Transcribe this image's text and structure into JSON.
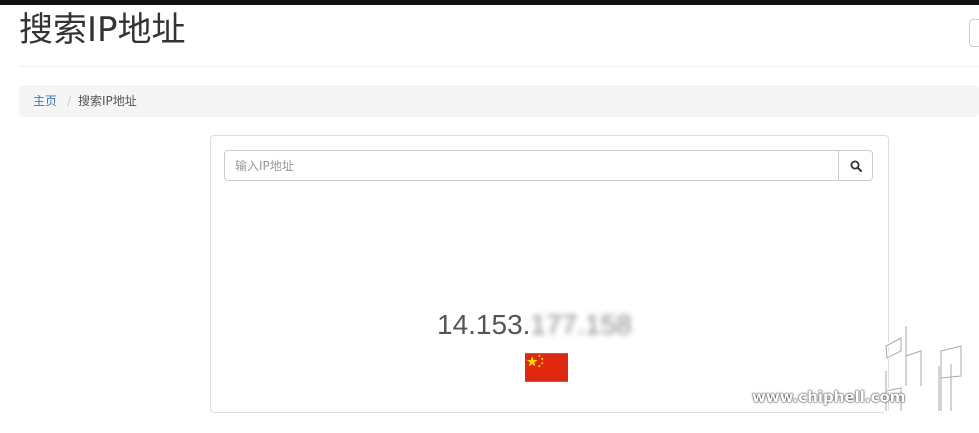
{
  "page": {
    "title": "搜索IP地址"
  },
  "breadcrumb": {
    "home": "主页",
    "separator": "/",
    "current": "搜索IP地址"
  },
  "search": {
    "placeholder": "输入IP地址",
    "value": "",
    "button_icon": "search-icon"
  },
  "result": {
    "ip_visible": "14.153.",
    "ip_obscured": "177.158",
    "country_flag": "china-flag"
  },
  "watermark": {
    "text": "www.chiphell.com"
  },
  "colors": {
    "link": "#337ab7",
    "breadcrumb_bg": "#f5f5f5",
    "flag_red": "#de2910",
    "flag_star": "#ffde00"
  }
}
